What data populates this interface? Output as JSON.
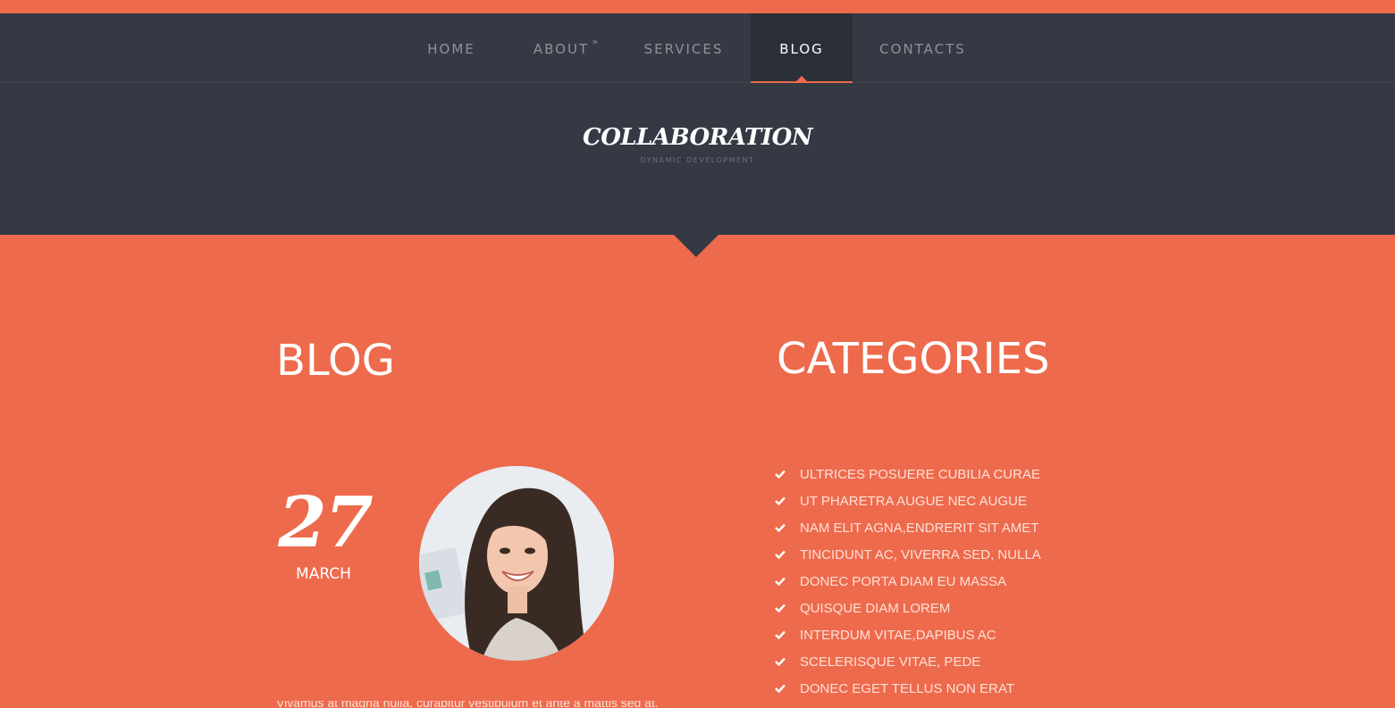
{
  "nav": {
    "items": [
      {
        "label": "HOME"
      },
      {
        "label": "ABOUT",
        "has_submenu": true,
        "submenu_glyph": "»"
      },
      {
        "label": "SERVICES"
      },
      {
        "label": "BLOG",
        "active": true
      },
      {
        "label": "CONTACTS"
      }
    ]
  },
  "header": {
    "logo_title": "COLLABORATION",
    "logo_subtitle": "DYNAMIC DEVELOPMENT"
  },
  "blog": {
    "heading": "BLOG",
    "post": {
      "day": "27",
      "month": "MARCH",
      "excerpt": "Vivamus at magna nulla, curabitur vestibulum et ante a mattis sed at."
    }
  },
  "categories": {
    "heading": "CATEGORIES",
    "items": [
      "ULTRICES POSUERE CUBILIA CURAE",
      "UT PHARETRA AUGUE NEC AUGUE",
      "NAM ELIT AGNA,ENDRERIT SIT AMET",
      "TINCIDUNT AC, VIVERRA SED, NULLA",
      "DONEC PORTA DIAM EU MASSA",
      "QUISQUE DIAM LOREM",
      "INTERDUM VITAE,DAPIBUS AC",
      "SCELERISQUE VITAE, PEDE",
      "DONEC EGET TELLUS NON ERAT"
    ],
    "bullet_icon": "check-icon"
  },
  "colors": {
    "accent": "#ee6a4c",
    "dark": "#343944",
    "nav_active_bg": "#2b2f38",
    "nav_text": "#8d929b"
  }
}
